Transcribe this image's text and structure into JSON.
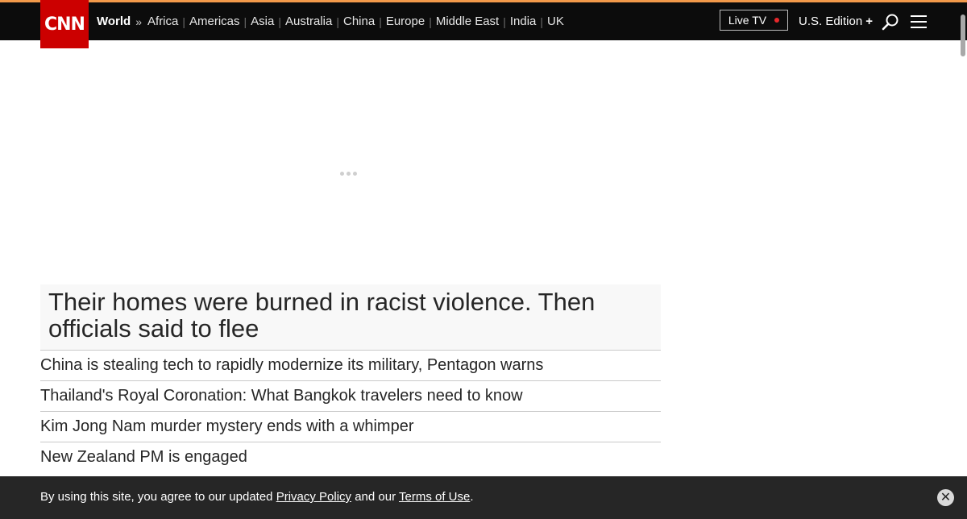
{
  "header": {
    "logo_text": "CNN",
    "section": "World",
    "section_chevron": "»",
    "nav_links": [
      "Africa",
      "Americas",
      "Asia",
      "Australia",
      "China",
      "Europe",
      "Middle East",
      "India",
      "UK"
    ],
    "live_tv": "Live TV",
    "edition": "U.S. Edition",
    "edition_icon": "+",
    "search_icon": "search-icon",
    "menu_icon": "menu-icon"
  },
  "colors": {
    "brand_red": "#cc0000",
    "topbar_bg": "#0c0c0c",
    "accent_stripe": "#f2994a",
    "live_dot": "#e8282b",
    "consent_bg": "#262626"
  },
  "headlines": {
    "feature": "Their homes were burned in racist violence. Then officials said to flee",
    "items": [
      "China is stealing tech to rapidly modernize its military, Pentagon warns",
      "Thailand's Royal Coronation: What Bangkok travelers need to know",
      "Kim Jong Nam murder mystery ends with a whimper",
      "New Zealand PM is engaged"
    ]
  },
  "consent": {
    "text_before": "By using this site, you agree to our updated ",
    "privacy_link": "Privacy Policy",
    "text_middle": " and our ",
    "terms_link": "Terms of Use",
    "text_after": ".",
    "close_glyph": "✕"
  }
}
